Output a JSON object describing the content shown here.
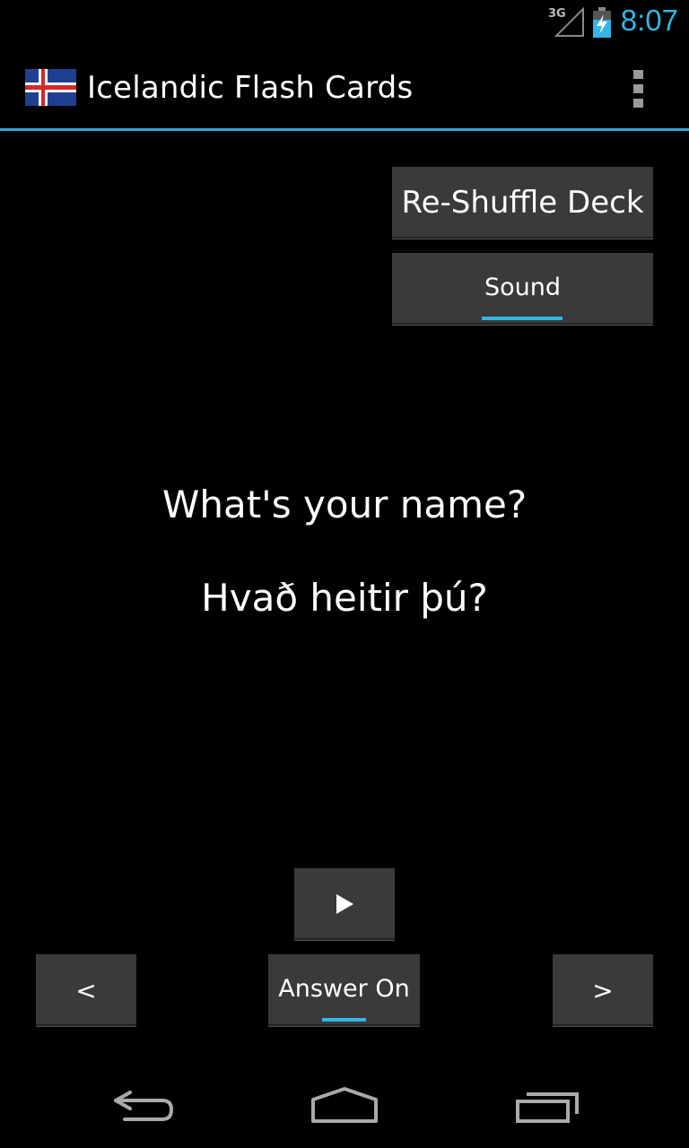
{
  "status_bar": {
    "network": "3G",
    "time": "8:07",
    "icons": [
      "signal-icon",
      "battery-charging-icon"
    ]
  },
  "action_bar": {
    "title": "Icelandic Flash Cards",
    "icon": "iceland-flag-icon",
    "overflow_icon": "overflow-menu-icon"
  },
  "controls": {
    "reshuffle_label": "Re-Shuffle Deck",
    "sound_label": "Sound",
    "sound_on": true
  },
  "card": {
    "question": "What's your name?",
    "answer": "Hvað heitir þú?"
  },
  "bottom": {
    "play_icon": "play-icon",
    "prev_label": "<",
    "answer_label": "Answer On",
    "answer_on": true,
    "next_label": ">"
  },
  "nav_bar": {
    "icons": [
      "back-icon",
      "home-icon",
      "recent-apps-icon"
    ]
  },
  "colors": {
    "accent": "#33b5e5",
    "button": "#3a3a3a",
    "background": "#000000"
  }
}
